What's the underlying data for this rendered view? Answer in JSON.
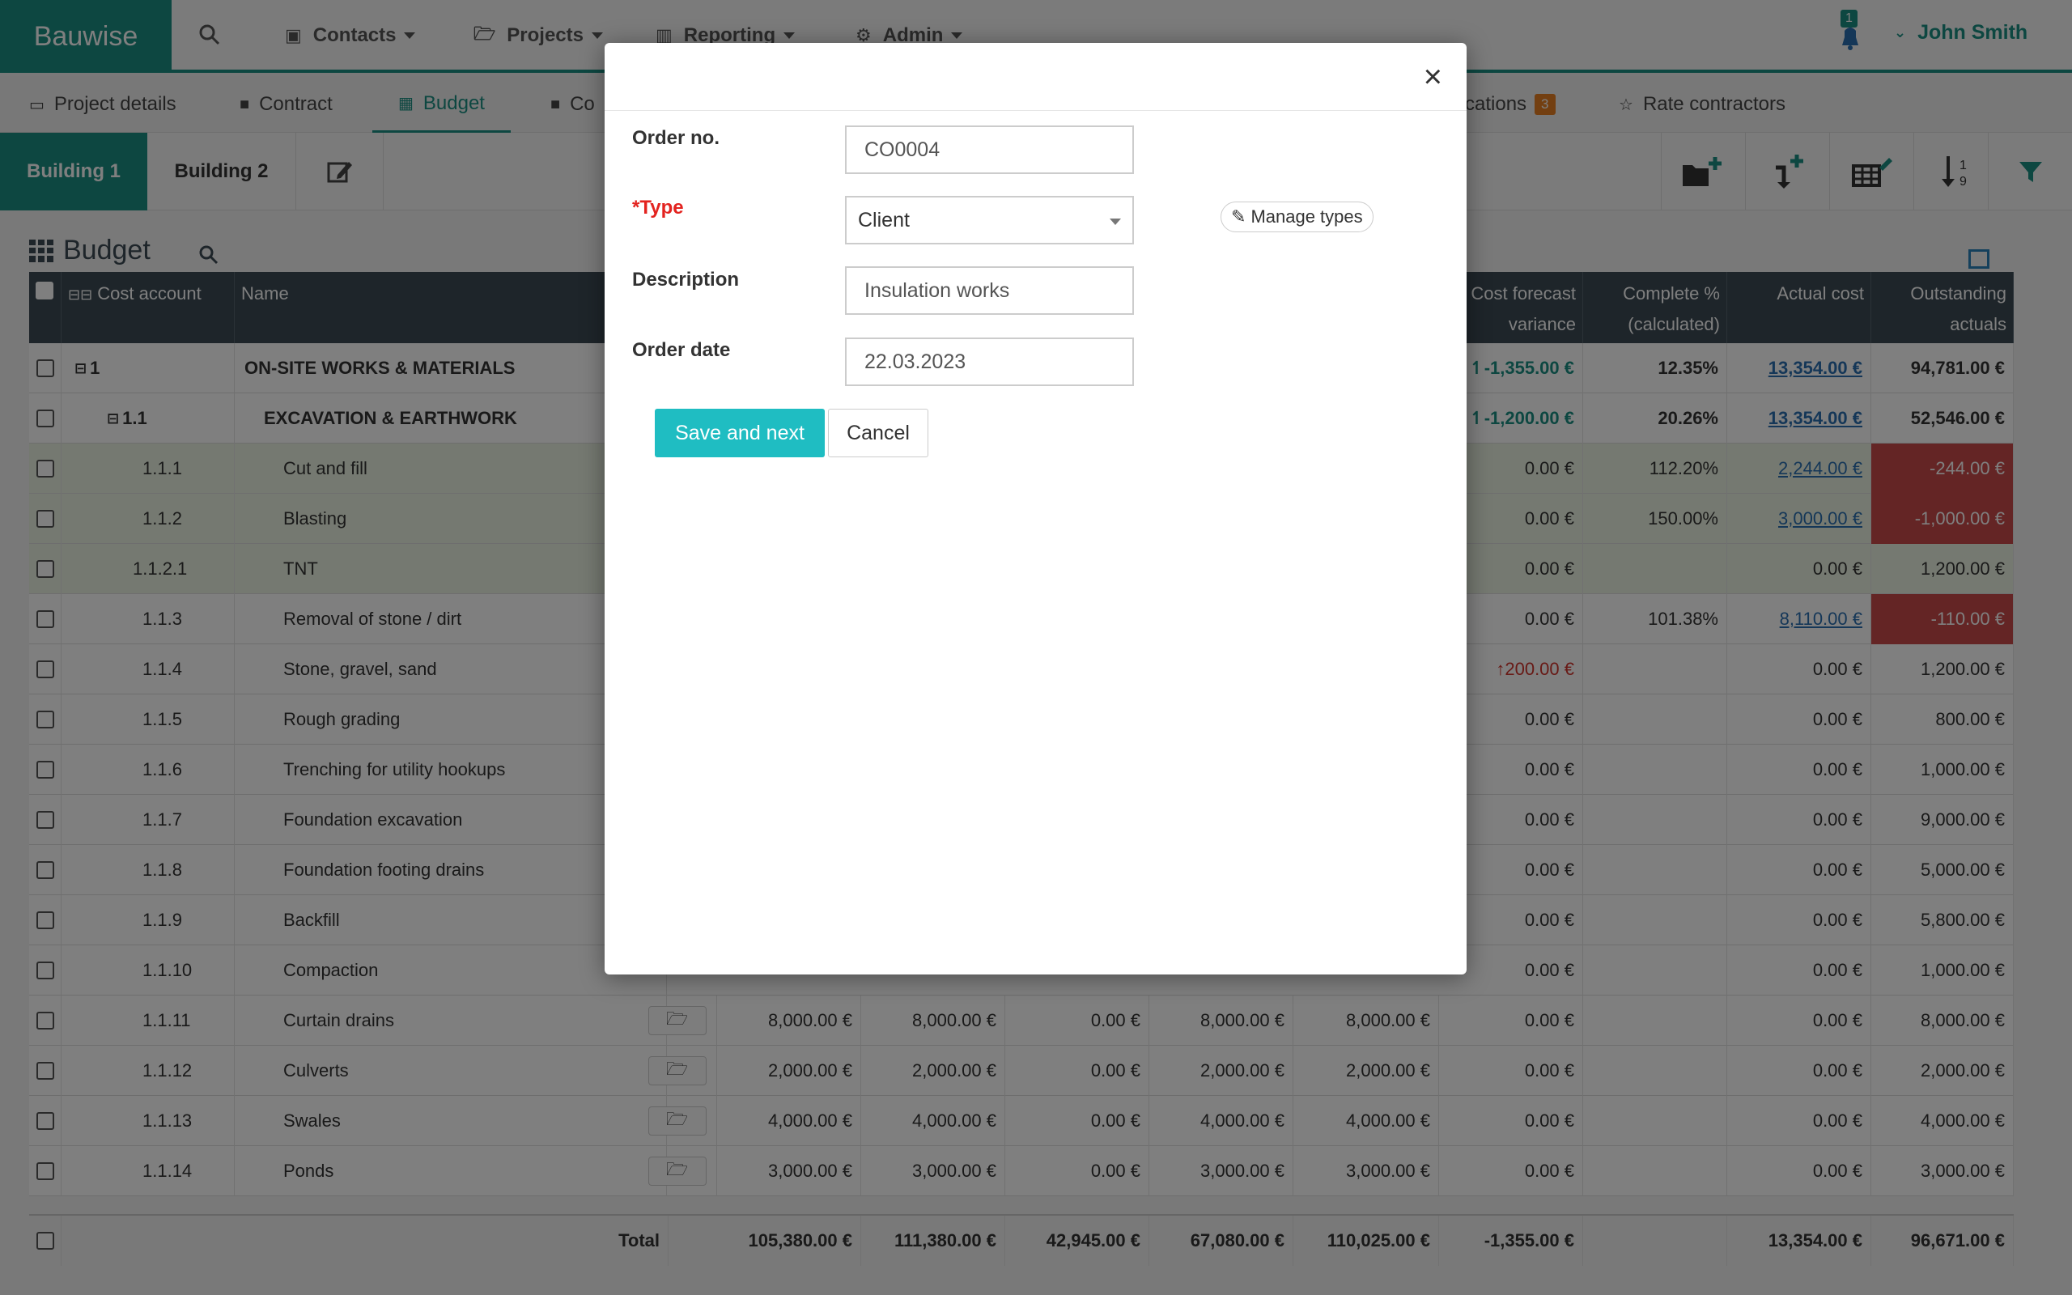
{
  "app": {
    "brand": "Bauwise",
    "user": "John Smith",
    "notifications": "1"
  },
  "nav": {
    "contacts": "Contacts",
    "projects": "Projects",
    "reporting": "Reporting",
    "admin": "Admin"
  },
  "subnav": {
    "project_details": "Project details",
    "contract": "Contract",
    "budget": "Budget",
    "change_orders_partial": "Co",
    "notifications_partial": "cations",
    "notifications_count": "3",
    "rate_contractors": "Rate contractors"
  },
  "buildings": {
    "b1": "Building 1",
    "b2": "Building 2"
  },
  "budget": {
    "title": "Budget",
    "headers": {
      "cost_account": "Cost account",
      "name": "Name",
      "cost_forecast_variance": "Cost forecast variance",
      "complete_pct": "Complete % (calculated)",
      "actual_cost": "Actual cost",
      "outstanding": "Outstanding actuals"
    },
    "rows": [
      {
        "code": "1",
        "name": "ON-SITE WORKS & MATERIALS",
        "variance": "-1,355.00 €",
        "complete": "12.35%",
        "actual": "13,354.00 €",
        "outstanding": "94,781.00 €"
      },
      {
        "code": "1.1",
        "name": "EXCAVATION & EARTHWORK",
        "variance": "-1,200.00 €",
        "complete": "20.26%",
        "actual": "13,354.00 €",
        "outstanding": "52,546.00 €"
      },
      {
        "code": "1.1.1",
        "name": "Cut and fill",
        "variance": "0.00 €",
        "complete": "112.20%",
        "actual": "2,244.00 €",
        "outstanding": "-244.00 €"
      },
      {
        "code": "1.1.2",
        "name": "Blasting",
        "variance": "0.00 €",
        "complete": "150.00%",
        "actual": "3,000.00 €",
        "outstanding": "-1,000.00 €"
      },
      {
        "code": "1.1.2.1",
        "name": "TNT",
        "variance": "0.00 €",
        "complete": "",
        "actual": "0.00 €",
        "outstanding": "1,200.00 €"
      },
      {
        "code": "1.1.3",
        "name": "Removal of stone / dirt",
        "variance": "0.00 €",
        "complete": "101.38%",
        "actual": "8,110.00 €",
        "outstanding": "-110.00 €"
      },
      {
        "code": "1.1.4",
        "name": "Stone, gravel, sand",
        "variance": "200.00 €",
        "complete": "",
        "actual": "0.00 €",
        "outstanding": "1,200.00 €"
      },
      {
        "code": "1.1.5",
        "name": "Rough grading",
        "variance": "0.00 €",
        "complete": "",
        "actual": "0.00 €",
        "outstanding": "800.00 €"
      },
      {
        "code": "1.1.6",
        "name": "Trenching for utility hookups",
        "variance": "0.00 €",
        "complete": "",
        "actual": "0.00 €",
        "outstanding": "1,000.00 €"
      },
      {
        "code": "1.1.7",
        "name": "Foundation excavation",
        "variance": "0.00 €",
        "complete": "",
        "actual": "0.00 €",
        "outstanding": "9,000.00 €"
      },
      {
        "code": "1.1.8",
        "name": "Foundation footing drains",
        "variance": "0.00 €",
        "complete": "",
        "actual": "0.00 €",
        "outstanding": "5,000.00 €"
      },
      {
        "code": "1.1.9",
        "name": "Backfill",
        "variance": "0.00 €",
        "complete": "",
        "actual": "0.00 €",
        "outstanding": "5,800.00 €"
      },
      {
        "code": "1.1.10",
        "name": "Compaction",
        "variance": "0.00 €",
        "complete": "",
        "actual": "0.00 €",
        "outstanding": "1,000.00 €"
      },
      {
        "code": "1.1.11",
        "name": "Curtain drains",
        "v1": "8,000.00 €",
        "v2": "8,000.00 €",
        "v3": "0.00 €",
        "v4": "8,000.00 €",
        "v5": "8,000.00 €",
        "variance": "0.00 €",
        "complete": "",
        "actual": "0.00 €",
        "outstanding": "8,000.00 €"
      },
      {
        "code": "1.1.12",
        "name": "Culverts",
        "v1": "2,000.00 €",
        "v2": "2,000.00 €",
        "v3": "0.00 €",
        "v4": "2,000.00 €",
        "v5": "2,000.00 €",
        "variance": "0.00 €",
        "complete": "",
        "actual": "0.00 €",
        "outstanding": "2,000.00 €"
      },
      {
        "code": "1.1.13",
        "name": "Swales",
        "v1": "4,000.00 €",
        "v2": "4,000.00 €",
        "v3": "0.00 €",
        "v4": "4,000.00 €",
        "v5": "4,000.00 €",
        "variance": "0.00 €",
        "complete": "",
        "actual": "0.00 €",
        "outstanding": "4,000.00 €"
      },
      {
        "code": "1.1.14",
        "name": "Ponds",
        "v1": "3,000.00 €",
        "v2": "3,000.00 €",
        "v3": "0.00 €",
        "v4": "3,000.00 €",
        "v5": "3,000.00 €",
        "variance": "0.00 €",
        "complete": "",
        "actual": "0.00 €",
        "outstanding": "3,000.00 €"
      }
    ],
    "totals": {
      "label": "Total",
      "t1": "105,380.00 €",
      "t2": "111,380.00 €",
      "t3": "42,945.00 €",
      "t4": "67,080.00 €",
      "t5": "110,025.00 €",
      "variance": "-1,355.00 €",
      "actual": "13,354.00 €",
      "outstanding": "96,671.00 €"
    }
  },
  "modal": {
    "close_label": "×",
    "order_no_label": "Order no.",
    "order_no_value": "CO0004",
    "type_label": "*Type",
    "type_value": "Client",
    "manage_types": "Manage types",
    "description_label": "Description",
    "description_value": "Insulation works",
    "order_date_label": "Order date",
    "order_date_value": "22.03.2023",
    "save_next": "Save and next",
    "cancel": "Cancel"
  }
}
